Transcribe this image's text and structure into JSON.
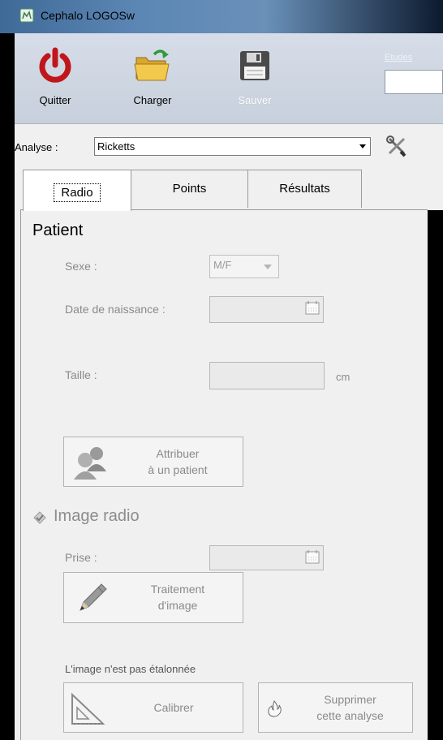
{
  "window": {
    "title": "Cephalo LOGOSw"
  },
  "toolbar": {
    "quit_label": "Quitter",
    "load_label": "Charger",
    "save_label": "Sauver",
    "studies_label": "Etudes"
  },
  "analysis": {
    "label": "Analyse :",
    "selected": "Ricketts"
  },
  "tabs": [
    {
      "label": "Radio",
      "active": true
    },
    {
      "label": "Points",
      "active": false
    },
    {
      "label": "Résultats",
      "active": false
    }
  ],
  "patient": {
    "title": "Patient",
    "sex_label": "Sexe :",
    "sex_value": "M/F",
    "birth_label": "Date de naissance :",
    "height_label": "Taille :",
    "height_unit": "cm",
    "assign_button": {
      "line1": "Attribuer",
      "line2": "à un patient"
    }
  },
  "image": {
    "title": "Image radio",
    "taken_label": "Prise :",
    "processing_button": {
      "line1": "Traitement",
      "line2": "d'image"
    },
    "calibration_status": "L'image n'est pas étalonnée",
    "calibrate_button": "Calibrer",
    "delete_button": {
      "line1": "Supprimer",
      "line2": "cette analyse"
    }
  },
  "colors": {
    "titlebar": "#5b86b4",
    "toolbar": "#cfd7e2",
    "power_red": "#c0161b",
    "folder_yellow": "#f2c94c",
    "arrow_green": "#2f9a3a",
    "disabled_text": "#8a8a8a"
  }
}
